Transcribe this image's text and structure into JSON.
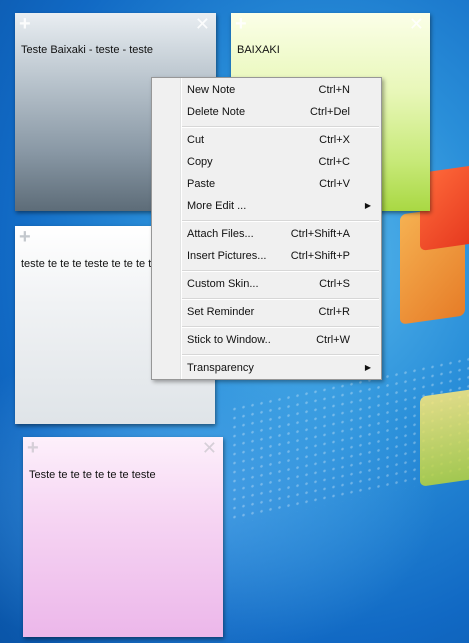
{
  "notes": [
    {
      "text": "Teste Baixaki - teste - teste",
      "color": "#8998a5"
    },
    {
      "text": "BAIXAKI",
      "color": "#c7e978"
    },
    {
      "text": "teste te te te teste te te te teste",
      "color": "#dfe4e8"
    },
    {
      "text": "Teste te te te te te te teste",
      "color": "#ecb7ea"
    }
  ],
  "note_controls": {
    "add": "+",
    "close": "✕"
  },
  "context_menu": {
    "items": [
      {
        "label": "New Note",
        "shortcut": "Ctrl+N"
      },
      {
        "label": "Delete Note",
        "shortcut": "Ctrl+Del"
      },
      {
        "label": "Cut",
        "shortcut": "Ctrl+X"
      },
      {
        "label": "Copy",
        "shortcut": "Ctrl+C"
      },
      {
        "label": "Paste",
        "shortcut": "Ctrl+V"
      },
      {
        "label": "More Edit ...",
        "submenu": true
      },
      {
        "label": "Attach Files...",
        "shortcut": "Ctrl+Shift+A"
      },
      {
        "label": "Insert Pictures...",
        "shortcut": "Ctrl+Shift+P"
      },
      {
        "label": "Custom Skin...",
        "shortcut": "Ctrl+S"
      },
      {
        "label": "Set Reminder",
        "shortcut": "Ctrl+R"
      },
      {
        "label": "Stick to Window..",
        "shortcut": "Ctrl+W"
      },
      {
        "label": "Transparency",
        "submenu": true
      }
    ],
    "submenu_arrow": "▶"
  }
}
